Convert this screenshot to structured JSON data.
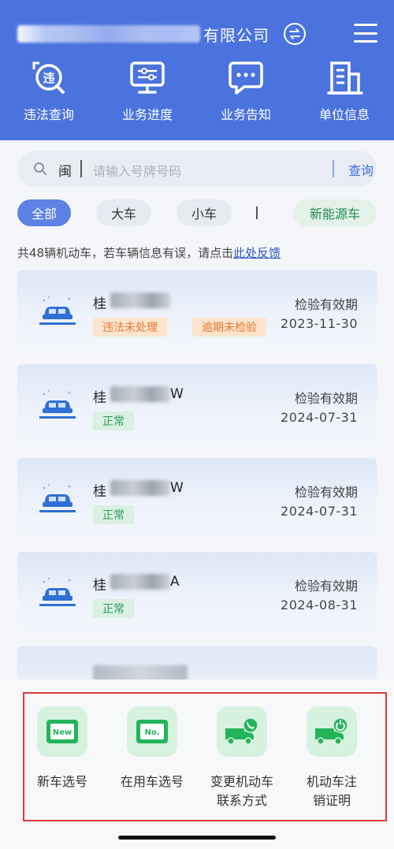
{
  "header": {
    "company_suffix": "有限公司"
  },
  "nav": [
    {
      "label": "违法查询"
    },
    {
      "label": "业务进度"
    },
    {
      "label": "业务告知"
    },
    {
      "label": "单位信息"
    }
  ],
  "search": {
    "province": "闽",
    "placeholder": "请输入号牌号码",
    "button": "查询"
  },
  "filters": {
    "all": "全部",
    "big": "大车",
    "small": "小车",
    "new_energy": "新能源车"
  },
  "notice": {
    "text": "共48辆机动车，若车辆信息有误，请点击",
    "link": "此处反馈"
  },
  "vehicles": [
    {
      "plate_prefix": "桂",
      "plate_suffix": "",
      "tags": [
        "违法未处理",
        "逾期未检验"
      ],
      "expiry_label": "检验有效期",
      "expiry_date": "2023-11-30"
    },
    {
      "plate_prefix": "桂",
      "plate_suffix": "W",
      "tags": [
        "正常"
      ],
      "expiry_label": "检验有效期",
      "expiry_date": "2024-07-31"
    },
    {
      "plate_prefix": "桂",
      "plate_suffix": "W",
      "tags": [
        "正常"
      ],
      "expiry_label": "检验有效期",
      "expiry_date": "2024-07-31"
    },
    {
      "plate_prefix": "桂",
      "plate_suffix": "A",
      "tags": [
        "正常"
      ],
      "expiry_label": "检验有效期",
      "expiry_date": "2024-08-31"
    }
  ],
  "services": [
    {
      "label_1": "新车选号",
      "label_2": "",
      "icon_text": "New"
    },
    {
      "label_1": "在用车选号",
      "label_2": "",
      "icon_text": "No."
    },
    {
      "label_1": "变更机动车",
      "label_2": "联系方式",
      "icon_text": ""
    },
    {
      "label_1": "机动车注",
      "label_2": "销证明",
      "icon_text": ""
    }
  ],
  "colors": {
    "header_bg": "#4a73dd",
    "accent_blue": "#3c6fdc",
    "tag_orange": "#e8772a",
    "tag_green": "#2a9a59",
    "highlight_border": "#d93a3a"
  }
}
